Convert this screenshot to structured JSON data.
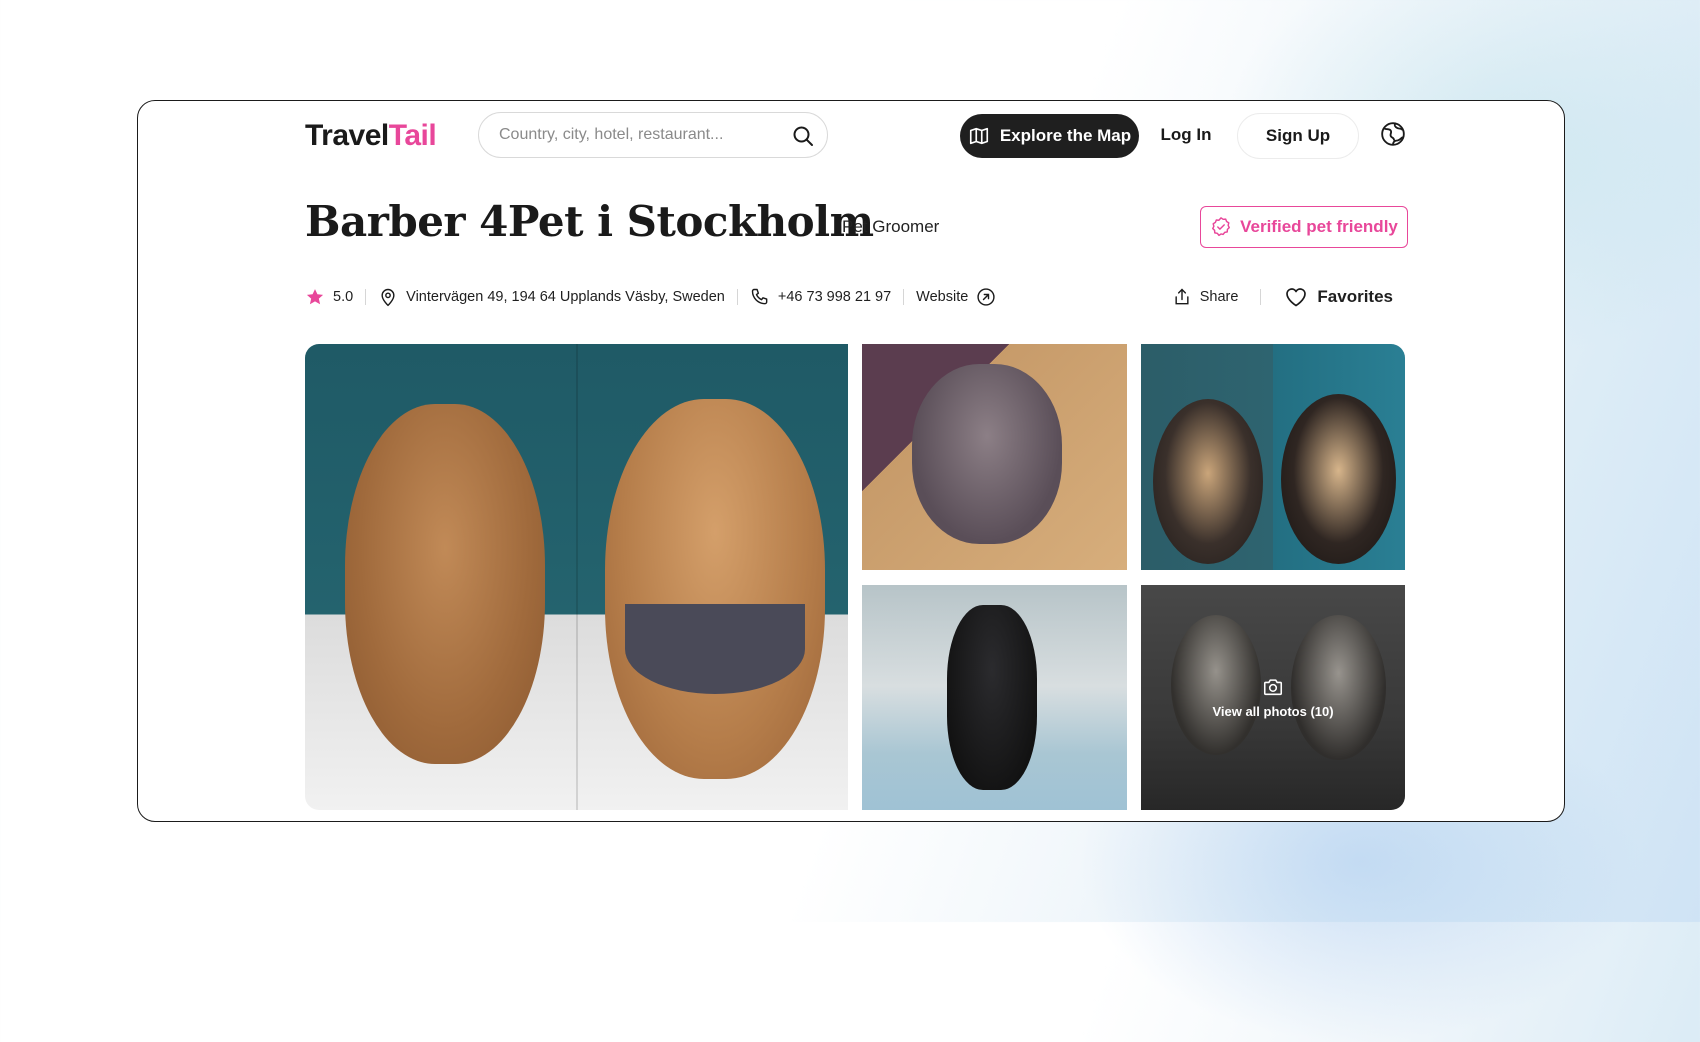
{
  "header": {
    "logo_part1": "Travel",
    "logo_part2": "Tail",
    "search_placeholder": "Country, city, hotel, restaurant...",
    "explore_label": "Explore the Map",
    "login_label": "Log In",
    "signup_label": "Sign Up",
    "icons": [
      "search-icon",
      "map-icon",
      "globe-icon"
    ]
  },
  "place": {
    "name": "Barber 4Pet i Stockholm",
    "category": "Pet Groomer",
    "verified_label": "Verified pet friendly",
    "rating": "5.0",
    "address": "Vintervägen 49, 194 64 Upplands Väsby, Sweden",
    "phone": "+46 73 998 21 97",
    "website_label": "Website",
    "share_label": "Share",
    "favorites_label": "Favorites"
  },
  "gallery": {
    "view_all_label": "View all photos (10)"
  },
  "colors": {
    "accent": "#e8479a",
    "dark": "#1f1f1f"
  }
}
